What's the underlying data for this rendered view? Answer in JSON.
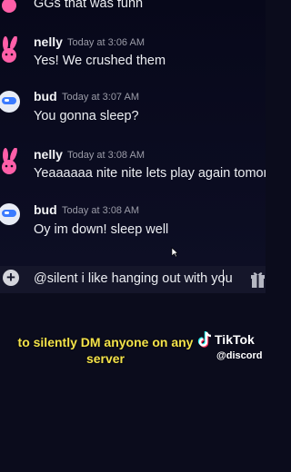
{
  "messages": [
    {
      "username": "",
      "timestamp": "",
      "text": "GGs that was funn",
      "avatar": "bunny-icon"
    },
    {
      "username": "nelly",
      "timestamp": "Today at 3:06 AM",
      "text": "Yes! We crushed them",
      "avatar": "bunny-icon"
    },
    {
      "username": "bud",
      "timestamp": "Today at 3:07 AM",
      "text": "You gonna sleep?",
      "avatar": "astronaut-icon"
    },
    {
      "username": "nelly",
      "timestamp": "Today at 3:08 AM",
      "text": "Yeaaaaaa nite nite lets play again tomorrow",
      "avatar": "bunny-icon"
    },
    {
      "username": "bud",
      "timestamp": "Today at 3:08 AM",
      "text": "Oy im down! sleep well",
      "avatar": "astronaut-icon"
    }
  ],
  "composer": {
    "value": "@silent i like hanging out with you"
  },
  "caption": {
    "line1": "to silently DM anyone on any",
    "line2": "server"
  },
  "tiktok": {
    "name": "TikTok",
    "handle": "@discord"
  },
  "colors": {
    "accent": "#f4e34a",
    "bunny": "#ff5fa8",
    "astronaut": "#3b7bff"
  }
}
